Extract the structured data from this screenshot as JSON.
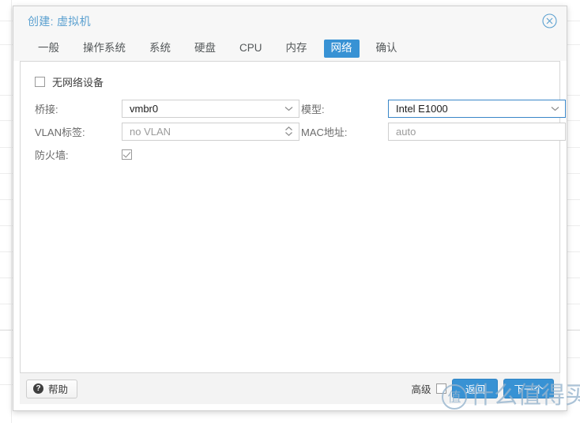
{
  "window": {
    "title": "创建: 虚拟机",
    "close_icon": "close-circle-icon"
  },
  "tabs": [
    {
      "label": "一般",
      "active": false
    },
    {
      "label": "操作系统",
      "active": false
    },
    {
      "label": "系统",
      "active": false
    },
    {
      "label": "硬盘",
      "active": false
    },
    {
      "label": "CPU",
      "active": false
    },
    {
      "label": "内存",
      "active": false
    },
    {
      "label": "网络",
      "active": true
    },
    {
      "label": "确认",
      "active": false
    }
  ],
  "form": {
    "no_network_device": {
      "label": "无网络设备",
      "checked": false
    },
    "left": [
      {
        "label": "桥接:",
        "value": "vmbr0",
        "type": "combobox",
        "icon": "chevron-down-icon",
        "focused": false,
        "placeholder": false
      },
      {
        "label": "VLAN标签:",
        "value": "no VLAN",
        "type": "spinner",
        "icon": "spinner-updown-icon",
        "focused": false,
        "placeholder": true
      }
    ],
    "firewall": {
      "label": "防火墙:",
      "checked": true
    },
    "right": [
      {
        "label": "模型:",
        "value": "Intel E1000",
        "type": "combobox",
        "icon": "chevron-down-icon",
        "focused": true,
        "placeholder": false
      },
      {
        "label": "MAC地址:",
        "value": "auto",
        "type": "text",
        "icon": "",
        "focused": false,
        "placeholder": true
      }
    ]
  },
  "footer": {
    "help_label": "帮助",
    "help_icon": "question-mark-icon",
    "advanced_label": "高级",
    "advanced_checked": false,
    "back_label": "返回",
    "next_label": "下一个"
  },
  "watermark": {
    "text": "什么值得买",
    "logo_char": "值"
  },
  "colors": {
    "accent": "#3892d4",
    "title": "#5ba0d0",
    "header_bg": "#f7f7f7",
    "footer_bg": "#f3f3f3",
    "field_border": "#cfcfcf",
    "focus_border": "#3a87c8",
    "label": "#6b6b6b"
  }
}
